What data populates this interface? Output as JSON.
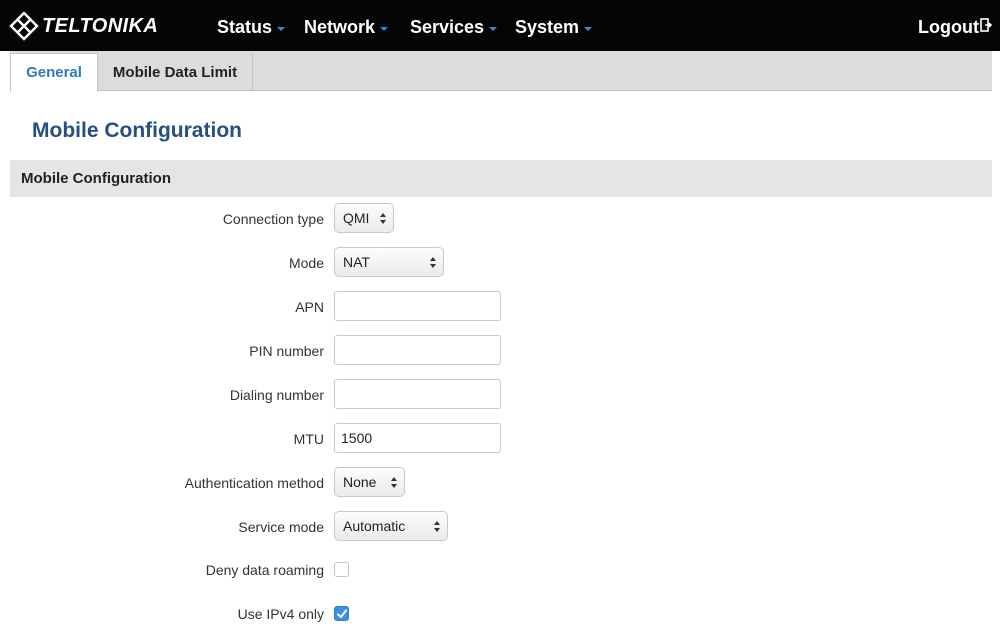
{
  "brand": {
    "name": "TELTONIKA",
    "logo_icon": "teltonika-logo-icon"
  },
  "nav": {
    "items": [
      {
        "label": "Status"
      },
      {
        "label": "Network"
      },
      {
        "label": "Services"
      },
      {
        "label": "System"
      }
    ],
    "logout_label": "Logout",
    "accent_color": "#2f8fd8"
  },
  "tabs": [
    {
      "label": "General",
      "active": true
    },
    {
      "label": "Mobile Data Limit",
      "active": false
    }
  ],
  "page_title": "Mobile Configuration",
  "section_title": "Mobile Configuration",
  "form": {
    "connection_type": {
      "label": "Connection type",
      "value": "QMI"
    },
    "mode": {
      "label": "Mode",
      "value": "NAT"
    },
    "apn": {
      "label": "APN",
      "value": ""
    },
    "pin_number": {
      "label": "PIN number",
      "value": ""
    },
    "dialing_number": {
      "label": "Dialing number",
      "value": ""
    },
    "mtu": {
      "label": "MTU",
      "value": "1500"
    },
    "authentication_method": {
      "label": "Authentication method",
      "value": "None"
    },
    "service_mode": {
      "label": "Service mode",
      "value": "Automatic"
    },
    "deny_data_roaming": {
      "label": "Deny data roaming",
      "checked": false
    },
    "use_ipv4_only": {
      "label": "Use IPv4 only",
      "checked": true
    }
  },
  "colors": {
    "title": "#254f86",
    "tab_active": "#2f7ab9",
    "checkbox_checked": "#3b8ee6"
  }
}
